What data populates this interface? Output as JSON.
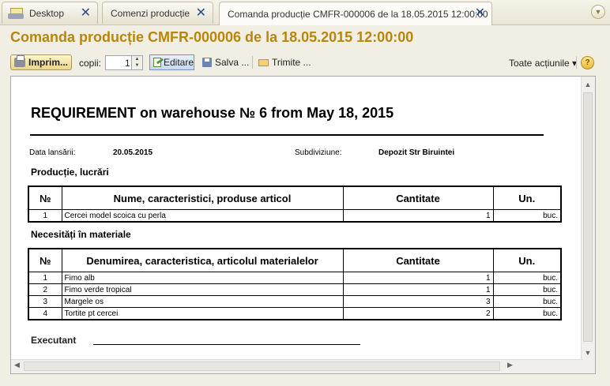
{
  "tabs": [
    {
      "label": "Desktop"
    },
    {
      "label": "Comenzi producție"
    },
    {
      "label": "Comanda producție CMFR-000006 de la 18.05.2015 12:00:00"
    }
  ],
  "form_title": "Comanda producție CMFR-000006 de la 18.05.2015 12:00:00",
  "toolbar": {
    "print_label": "Imprim...",
    "copies_label": "copii:",
    "copies_value": "1",
    "edit_label": "Editare",
    "save_label": "Salva ...",
    "send_label": "Trimite ...",
    "all_actions_label": "Toate acțiunile ▾",
    "help_label": "?"
  },
  "document": {
    "title": "REQUIREMENT on warehouse № 6 from May 18, 2015",
    "launch_date_label": "Data lansării:",
    "launch_date_value": "20.05.2015",
    "subdivision_label": "Subdiviziune:",
    "subdivision_value": "Depozit Str Biruintei",
    "products_section": "Producție, lucrări",
    "products_headers": [
      "№",
      "Nume, caracteristici, produse articol",
      "Cantitate",
      "Un."
    ],
    "products_rows": [
      {
        "no": "1",
        "name": "Cercei model scoica cu perla",
        "qty": "1",
        "unit": "buc."
      }
    ],
    "materials_section": "Necesități în materiale",
    "materials_headers": [
      "№",
      "Denumirea, caracteristica,  articolul materialelor",
      "Cantitate",
      "Un."
    ],
    "materials_rows": [
      {
        "no": "1",
        "name": "Fimo alb",
        "qty": "1",
        "unit": "buc."
      },
      {
        "no": "2",
        "name": "Fimo verde tropical",
        "qty": "1",
        "unit": "buc."
      },
      {
        "no": "3",
        "name": "Margele os",
        "qty": "3",
        "unit": "buc."
      },
      {
        "no": "4",
        "name": "Tortite pt cercei",
        "qty": "2",
        "unit": "buc."
      }
    ],
    "executant_label": "Executant"
  }
}
